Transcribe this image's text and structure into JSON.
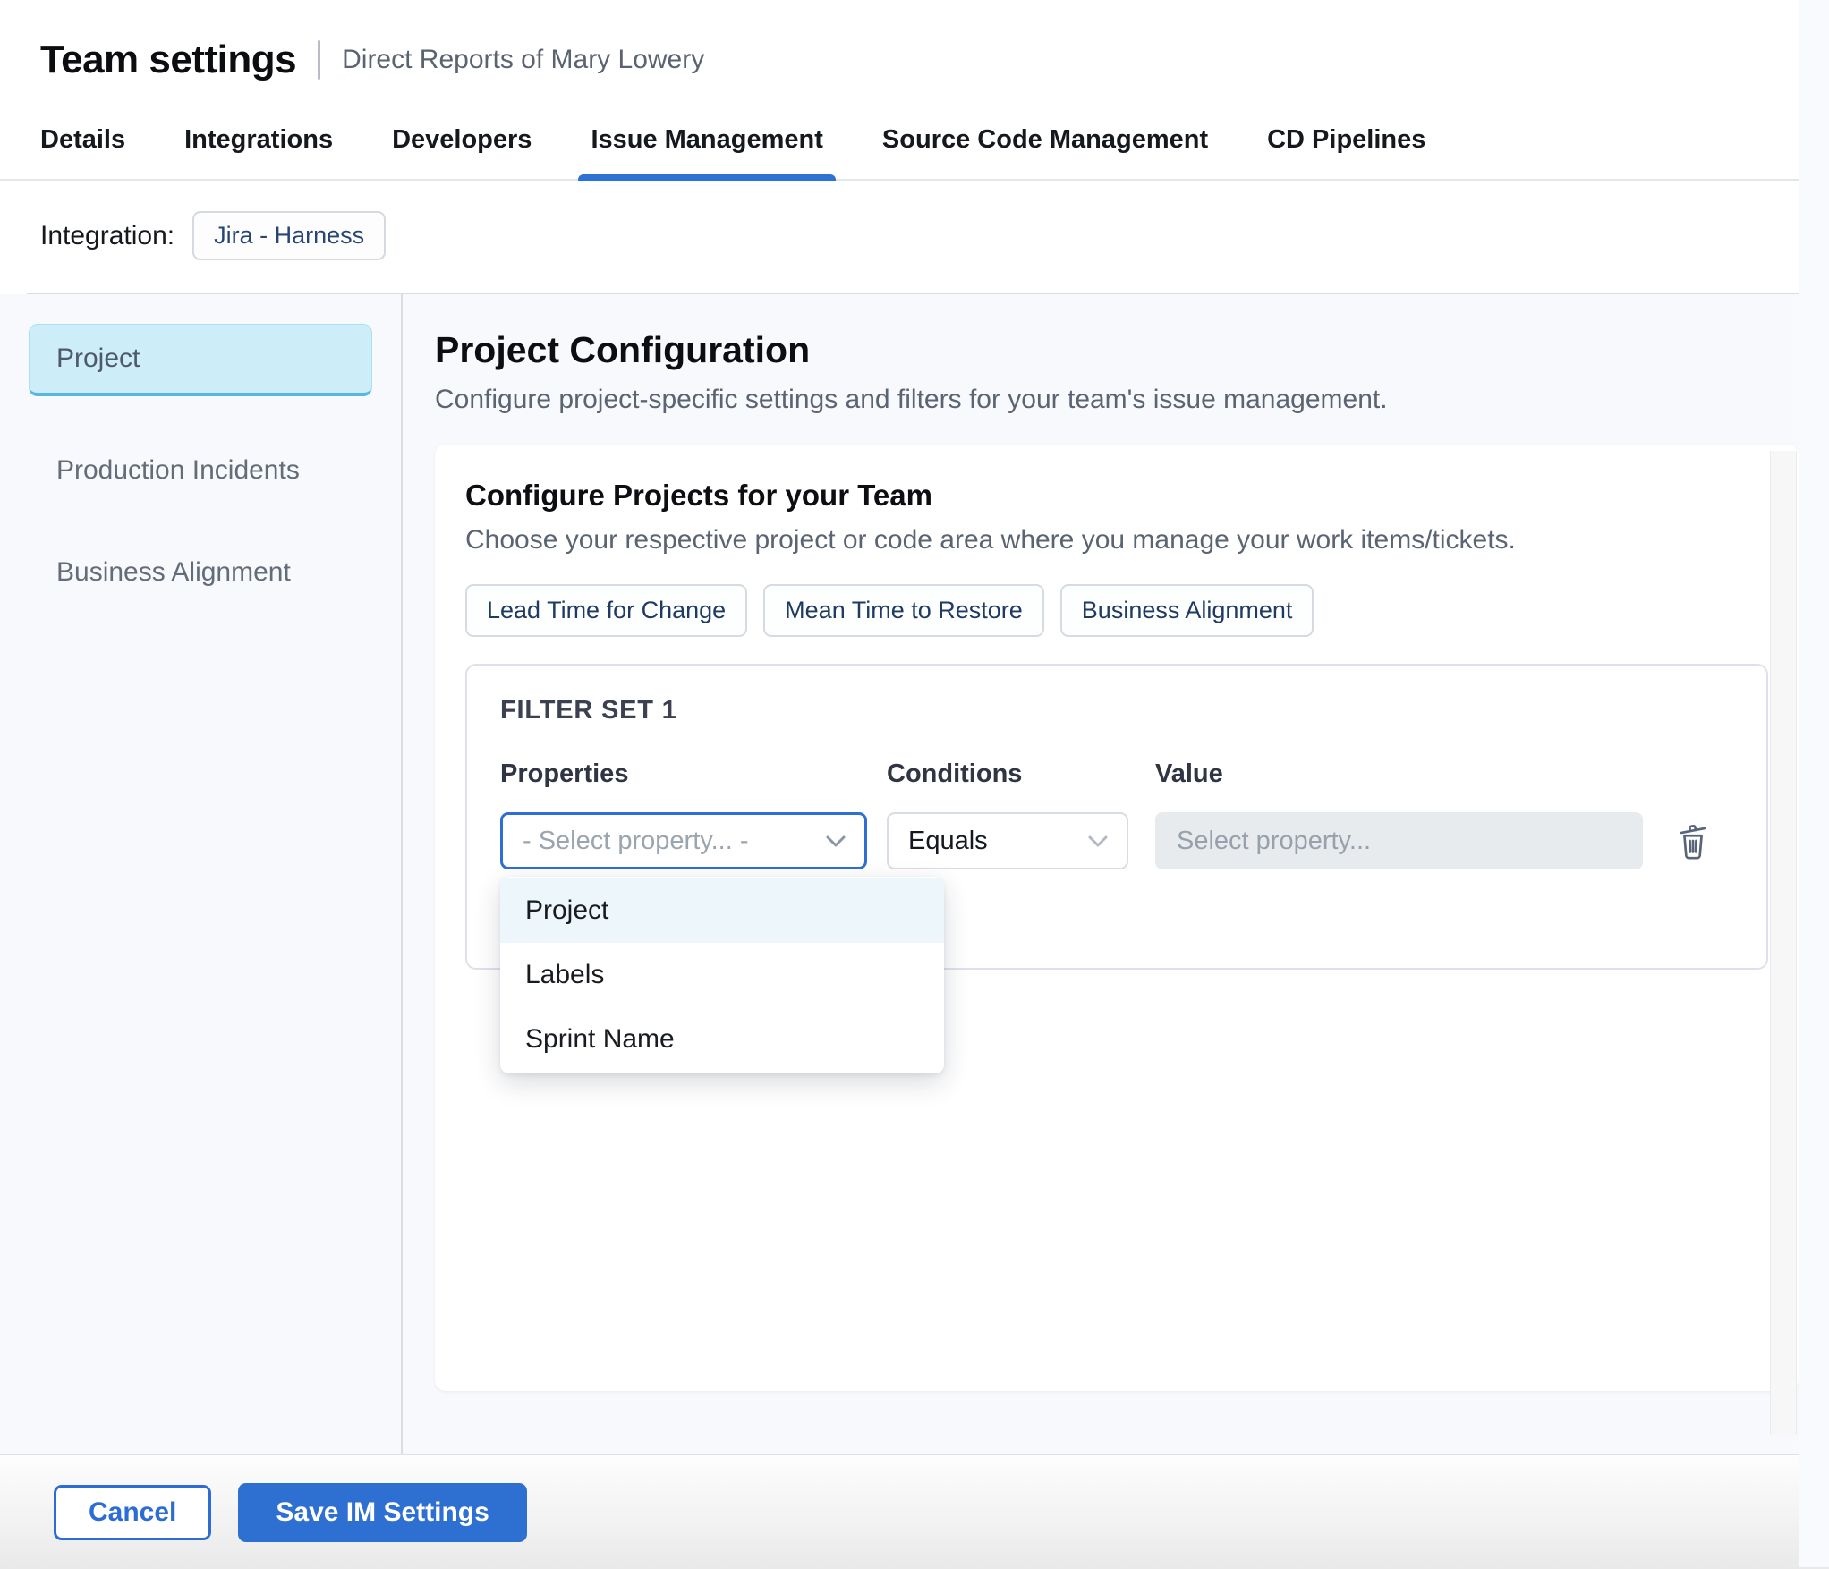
{
  "header": {
    "title": "Team settings",
    "subtitle": "Direct Reports of Mary Lowery"
  },
  "tabs": [
    {
      "label": "Details",
      "active": false
    },
    {
      "label": "Integrations",
      "active": false
    },
    {
      "label": "Developers",
      "active": false
    },
    {
      "label": "Issue Management",
      "active": true
    },
    {
      "label": "Source Code Management",
      "active": false
    },
    {
      "label": "CD Pipelines",
      "active": false
    }
  ],
  "integration": {
    "label": "Integration:",
    "chip": "Jira - Harness"
  },
  "sidebar": {
    "items": [
      {
        "label": "Project",
        "selected": true
      },
      {
        "label": "Production Incidents",
        "selected": false
      },
      {
        "label": "Business Alignment",
        "selected": false
      }
    ]
  },
  "main": {
    "title": "Project Configuration",
    "subtitle": "Configure project-specific settings and filters for your team's issue management.",
    "card": {
      "title": "Configure Projects for your Team",
      "subtitle": "Choose your respective project or code area where you manage your work items/tickets.",
      "chips": [
        "Lead Time for Change",
        "Mean Time to Restore",
        "Business Alignment"
      ],
      "filter_set": {
        "title": "FILTER SET 1",
        "columns": {
          "properties": "Properties",
          "conditions": "Conditions",
          "value": "Value"
        },
        "properties_placeholder": "- Select property... -",
        "conditions_value": "Equals",
        "value_placeholder": "Select property...",
        "dropdown_options": [
          {
            "label": "Project",
            "highlighted": true
          },
          {
            "label": "Labels",
            "highlighted": false
          },
          {
            "label": "Sprint Name",
            "highlighted": false
          }
        ]
      }
    }
  },
  "footer": {
    "cancel_label": "Cancel",
    "save_label": "Save IM Settings"
  },
  "icons": {
    "trash": "trash-icon",
    "chevron": "chevron-down-icon"
  },
  "colors": {
    "accent_blue": "#2e6fd2",
    "tab_underline": "#2e72d4",
    "selected_sidebar_bg": "#cdeef9",
    "selected_sidebar_border": "#57b8dd",
    "chip_text_navy": "#274676",
    "page_background": "#f8f9fc",
    "dropdown_highlight": "#ecf6fb",
    "disabled_input_bg": "#e7ebee"
  }
}
